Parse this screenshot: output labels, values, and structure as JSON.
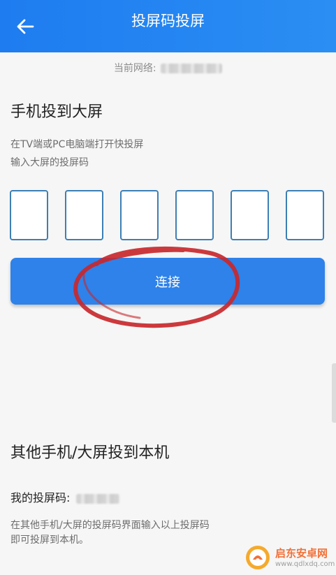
{
  "header": {
    "title": "投屏码投屏",
    "back_icon": "arrow-left-icon",
    "color": "#1e7cf0"
  },
  "network": {
    "label": "当前网络:"
  },
  "cast_section": {
    "title": "手机投到大屏",
    "hint_line1": "在TV端或PC电脑端打开快投屏",
    "hint_line2": "输入大屏的投屏码",
    "code_digits": [
      "",
      "",
      "",
      "",
      "",
      ""
    ],
    "connect_label": "连接",
    "annotation_color": "#c8282c"
  },
  "receive_section": {
    "title": "其他手机/大屏投到本机",
    "my_code_label": "我的投屏码:",
    "hint_line1": "在其他手机/大屏的投屏码界面输入以上投屏码",
    "hint_line2": "即可投屏到本机。"
  },
  "watermark": {
    "name": "启东安卓网",
    "url": "www.qdlxdq.com",
    "icon": "logo-icon"
  }
}
